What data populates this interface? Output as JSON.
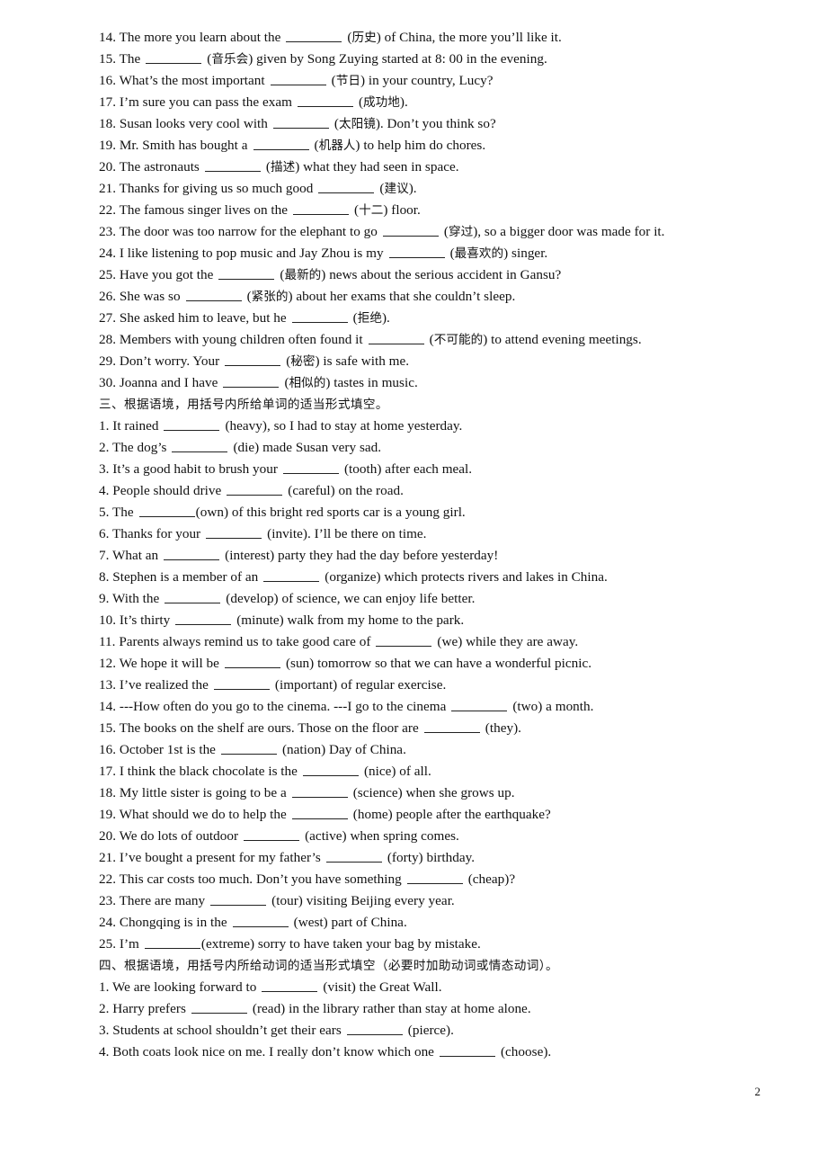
{
  "page": {
    "number": "2",
    "paper_size": "A4"
  },
  "blocks": [
    {
      "type": "items",
      "items": [
        {
          "num": "14.",
          "pre": "The more you learn about the",
          "blank": "md",
          "gap": true,
          "post": "(历史) of China, the more you’ll like it."
        },
        {
          "num": "15.",
          "pre": "The",
          "blank": "md",
          "gap": true,
          "post": "(音乐会) given by Song Zuying started at 8: 00 in the evening."
        },
        {
          "num": "16.",
          "pre": "What’s the most important",
          "blank": "md",
          "gap": true,
          "post": "(节日) in your country, Lucy?"
        },
        {
          "num": "17.",
          "pre": "I’m sure you can pass the exam",
          "blank": "md",
          "gap": true,
          "post": "(成功地)."
        },
        {
          "num": "18.",
          "pre": "Susan looks very cool with",
          "blank": "md",
          "gap": true,
          "post": "(太阳镜). Don’t you think so?"
        },
        {
          "num": "19.",
          "pre": "Mr. Smith has bought a",
          "blank": "md",
          "gap": true,
          "post": "(机器人) to help him do chores."
        },
        {
          "num": "20.",
          "pre": "The astronauts",
          "blank": "md",
          "gap": true,
          "post": "(描述) what they had seen in space."
        },
        {
          "num": "21.",
          "pre": "Thanks for giving us so much good",
          "blank": "md",
          "gap": true,
          "post": "(建议)."
        },
        {
          "num": "22.",
          "pre": "The famous singer lives on the",
          "blank": "md",
          "gap": true,
          "post": "(十二) floor."
        },
        {
          "num": "23.",
          "pre": "The door was too narrow for the elephant to go",
          "blank": "md",
          "gap": true,
          "post": "(穿过), so a bigger door was made for it."
        },
        {
          "num": "24.",
          "pre": "I like listening to pop music and Jay Zhou is my",
          "blank": "md",
          "gap": true,
          "post": "(最喜欢的) singer."
        },
        {
          "num": "25.",
          "pre": "Have you got the",
          "blank": "md",
          "gap": true,
          "post": "(最新的) news about the serious accident in Gansu?"
        },
        {
          "num": "26.",
          "pre": "She was so",
          "blank": "md",
          "gap": true,
          "post": "(紧张的) about her exams that she couldn’t sleep."
        },
        {
          "num": "27.",
          "pre": "She asked him to leave, but he",
          "blank": "md",
          "gap": true,
          "post": "(拒绝)."
        },
        {
          "num": "28.",
          "pre": "Members with young children often found it",
          "blank": "md",
          "gap": true,
          "post": "(不可能的) to attend evening meetings."
        },
        {
          "num": "29.",
          "pre": "Don’t worry. Your",
          "blank": "md",
          "gap": true,
          "post": "(秘密) is safe with me."
        },
        {
          "num": "30.",
          "pre": "Joanna and I have",
          "blank": "md",
          "gap": true,
          "post": "(相似的) tastes in music."
        }
      ]
    },
    {
      "type": "heading",
      "text": "三、根据语境，用括号内所给单词的适当形式填空。"
    },
    {
      "type": "items",
      "items": [
        {
          "num": "1.",
          "pre": "It rained",
          "blank": "md",
          "gap": true,
          "post": "(heavy), so I had to stay at home yesterday."
        },
        {
          "num": "2.",
          "pre": "The dog’s",
          "blank": "md",
          "gap": true,
          "post": "(die) made Susan very sad."
        },
        {
          "num": "3.",
          "pre": "It’s a good habit to brush your",
          "blank": "md",
          "gap": true,
          "post": "(tooth) after each meal."
        },
        {
          "num": "4.",
          "pre": "People should drive",
          "blank": "md",
          "gap": true,
          "post": "(careful) on the road."
        },
        {
          "num": "5.",
          "pre": "The",
          "blank": "md",
          "gap": false,
          "post": "(own) of this bright red sports car is a young girl."
        },
        {
          "num": "6.",
          "pre": "Thanks for your",
          "blank": "md",
          "gap": true,
          "post": "(invite). I’ll be there on time."
        },
        {
          "num": "7.",
          "pre": "What an",
          "blank": "md",
          "gap": true,
          "post": "(interest) party they had the day before yesterday!"
        },
        {
          "num": "8.",
          "pre": "Stephen is a member of an",
          "blank": "md",
          "gap": true,
          "post": "(organize) which protects rivers and lakes in China."
        },
        {
          "num": "9.",
          "pre": "With the",
          "blank": "md",
          "gap": true,
          "post": "(develop) of science, we can enjoy life better."
        },
        {
          "num": "10.",
          "pre": "It’s thirty",
          "blank": "md",
          "gap": true,
          "post": "(minute) walk from my home to the park."
        },
        {
          "num": "11.",
          "pre": "Parents always remind us to take good care of",
          "blank": "md",
          "gap": true,
          "post": "(we) while they are away."
        },
        {
          "num": "12.",
          "pre": "We hope it will be",
          "blank": "md",
          "gap": true,
          "post": "(sun) tomorrow so that we can have a wonderful picnic."
        },
        {
          "num": "13.",
          "pre": "I’ve realized the",
          "blank": "md",
          "gap": true,
          "post": "(important) of regular exercise."
        },
        {
          "num": "14.",
          "pre": "---How often do you go to the cinema. ---I go to the cinema",
          "blank": "md",
          "gap": true,
          "post": "(two) a month."
        },
        {
          "num": "15.",
          "pre": "The books on the shelf are ours. Those on the floor are",
          "blank": "md",
          "gap": true,
          "post": "(they)."
        },
        {
          "num": "16.",
          "pre": "October 1st is the",
          "blank": "md",
          "gap": true,
          "post": "(nation) Day of China."
        },
        {
          "num": "17.",
          "pre": "I think the black chocolate is the",
          "blank": "md",
          "gap": true,
          "post": "(nice) of all."
        },
        {
          "num": "18.",
          "pre": "My little sister is going to be a",
          "blank": "md",
          "gap": true,
          "post": "(science) when she grows up."
        },
        {
          "num": "19.",
          "pre": "What should we do to help the",
          "blank": "md",
          "gap": true,
          "post": "(home) people after the earthquake?"
        },
        {
          "num": "20.",
          "pre": "We do lots of outdoor",
          "blank": "md",
          "gap": true,
          "post": "(active) when spring comes."
        },
        {
          "num": "21.",
          "pre": "I’ve bought a present for my father’s",
          "blank": "md",
          "gap": true,
          "post": "(forty) birthday."
        },
        {
          "num": "22.",
          "pre": "This car costs too much. Don’t you have something",
          "blank": "md",
          "gap": true,
          "post": "(cheap)?"
        },
        {
          "num": "23.",
          "pre": "There are many",
          "blank": "md",
          "gap": true,
          "post": "(tour) visiting Beijing every year."
        },
        {
          "num": "24.",
          "pre": "Chongqing is in the",
          "blank": "md",
          "gap": true,
          "post": "(west) part of China."
        },
        {
          "num": "25.",
          "pre": "I’m",
          "blank": "md",
          "gap": false,
          "post": "(extreme) sorry to have taken your bag by mistake."
        }
      ]
    },
    {
      "type": "heading",
      "text": "四、根据语境，用括号内所给动词的适当形式填空（必要时加助动词或情态动词）。"
    },
    {
      "type": "items",
      "items": [
        {
          "num": "1.",
          "pre": "We are looking forward to",
          "blank": "md",
          "gap": true,
          "post": "(visit) the Great Wall."
        },
        {
          "num": "2.",
          "pre": "Harry prefers",
          "blank": "md",
          "gap": true,
          "post": "(read) in the library rather than stay at home alone."
        },
        {
          "num": "3.",
          "pre": "Students at school shouldn’t get their ears",
          "blank": "md",
          "gap": true,
          "post": "(pierce)."
        },
        {
          "num": "4.",
          "pre": "Both coats look nice on me. I really don’t know which one",
          "blank": "md",
          "gap": true,
          "post": "(choose)."
        }
      ]
    }
  ]
}
